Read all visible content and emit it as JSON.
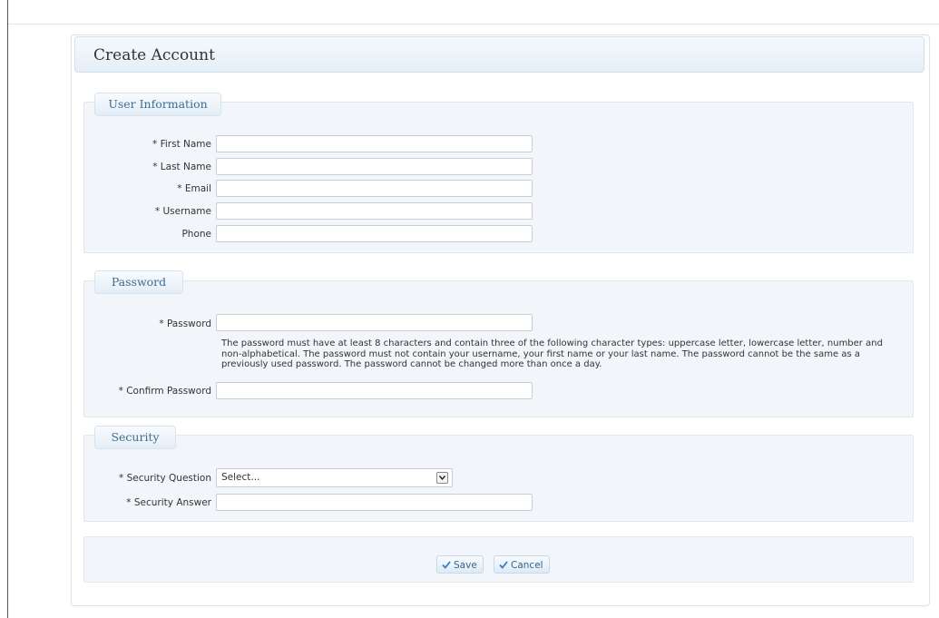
{
  "page": {
    "title": "Create Account"
  },
  "sections": {
    "user_info": {
      "legend": "User Information",
      "fields": {
        "first_name": {
          "label": "* First Name",
          "value": ""
        },
        "last_name": {
          "label": "* Last Name",
          "value": ""
        },
        "email": {
          "label": "* Email",
          "value": ""
        },
        "username": {
          "label": "* Username",
          "value": ""
        },
        "phone": {
          "label": "Phone",
          "value": ""
        }
      }
    },
    "password": {
      "legend": "Password",
      "fields": {
        "password": {
          "label": "* Password",
          "value": ""
        },
        "confirm_password": {
          "label": "* Confirm Password",
          "value": ""
        }
      },
      "help": "The password must have at least 8 characters and contain three of the following character types: uppercase letter, lowercase letter, number and non-alphabetical. The password must not contain your username, your first name or your last name. The password cannot be the same as a previously used password. The password cannot be changed more than once a day."
    },
    "security": {
      "legend": "Security",
      "fields": {
        "question": {
          "label": "* Security Question",
          "selected": "Select..."
        },
        "answer": {
          "label": "* Security Answer",
          "value": ""
        }
      }
    }
  },
  "actions": {
    "save_label": "Save",
    "cancel_label": "Cancel"
  },
  "icons": {
    "check": "checkmark-icon",
    "dropdown": "chevron-down-icon"
  },
  "colors": {
    "legend_text": "#3b6d93",
    "button_text": "#35648e",
    "section_bg": "#f2f6fa",
    "check": "#3b7dc4"
  }
}
